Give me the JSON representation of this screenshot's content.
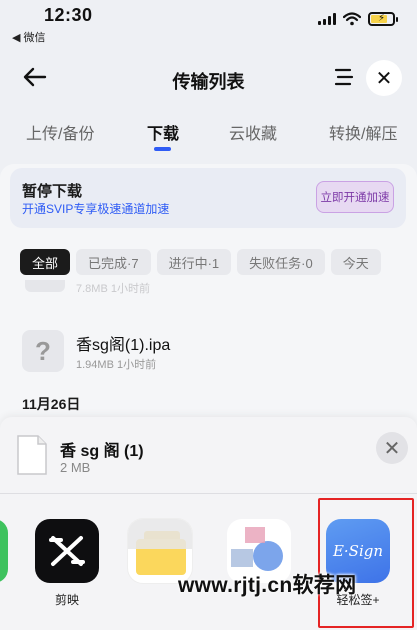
{
  "status_bar": {
    "time": "12:30",
    "back_app": "◀ 微信",
    "battery_glyph": "⚡"
  },
  "nav": {
    "title": "传输列表",
    "close_glyph": "✕"
  },
  "tabs": [
    {
      "label": "上传/备份",
      "active": false
    },
    {
      "label": "下载",
      "active": true
    },
    {
      "label": "云收藏",
      "active": false
    },
    {
      "label": "转换/解压",
      "active": false
    }
  ],
  "promo": {
    "title": "暂停下载",
    "subtitle": "开通SVIP专享极速通道加速",
    "button": "立即开通加速"
  },
  "filters": [
    {
      "label": "全部",
      "active": true
    },
    {
      "label": "已完成·7",
      "active": false
    },
    {
      "label": "进行中·1",
      "active": false
    },
    {
      "label": "失败任务·0",
      "active": false
    },
    {
      "label": "今天",
      "active": false
    }
  ],
  "partial_row_meta": "7.8MB  1小时前",
  "file": {
    "icon_glyph": "?",
    "name": "香sg阁(1).ipa",
    "meta": "1.94MB  1小时前"
  },
  "date_header": "11月26日",
  "share_sheet": {
    "title": "香 sg 阁 (1)",
    "size": "2 MB",
    "close_glyph": "✕",
    "apps": [
      {
        "label": "剪映",
        "icon": "capcut-icon"
      },
      {
        "label": "",
        "icon": "files-icon"
      },
      {
        "label": "",
        "icon": "app-icon"
      },
      {
        "label": "轻松签+",
        "icon": "esign-icon",
        "icon_text": "E·Sign"
      }
    ]
  },
  "watermark": "www.rjtj.cn软荐网",
  "colors": {
    "accent": "#2f5cf5",
    "promo_button": "#7d3aa7",
    "highlight": "#e52424"
  }
}
